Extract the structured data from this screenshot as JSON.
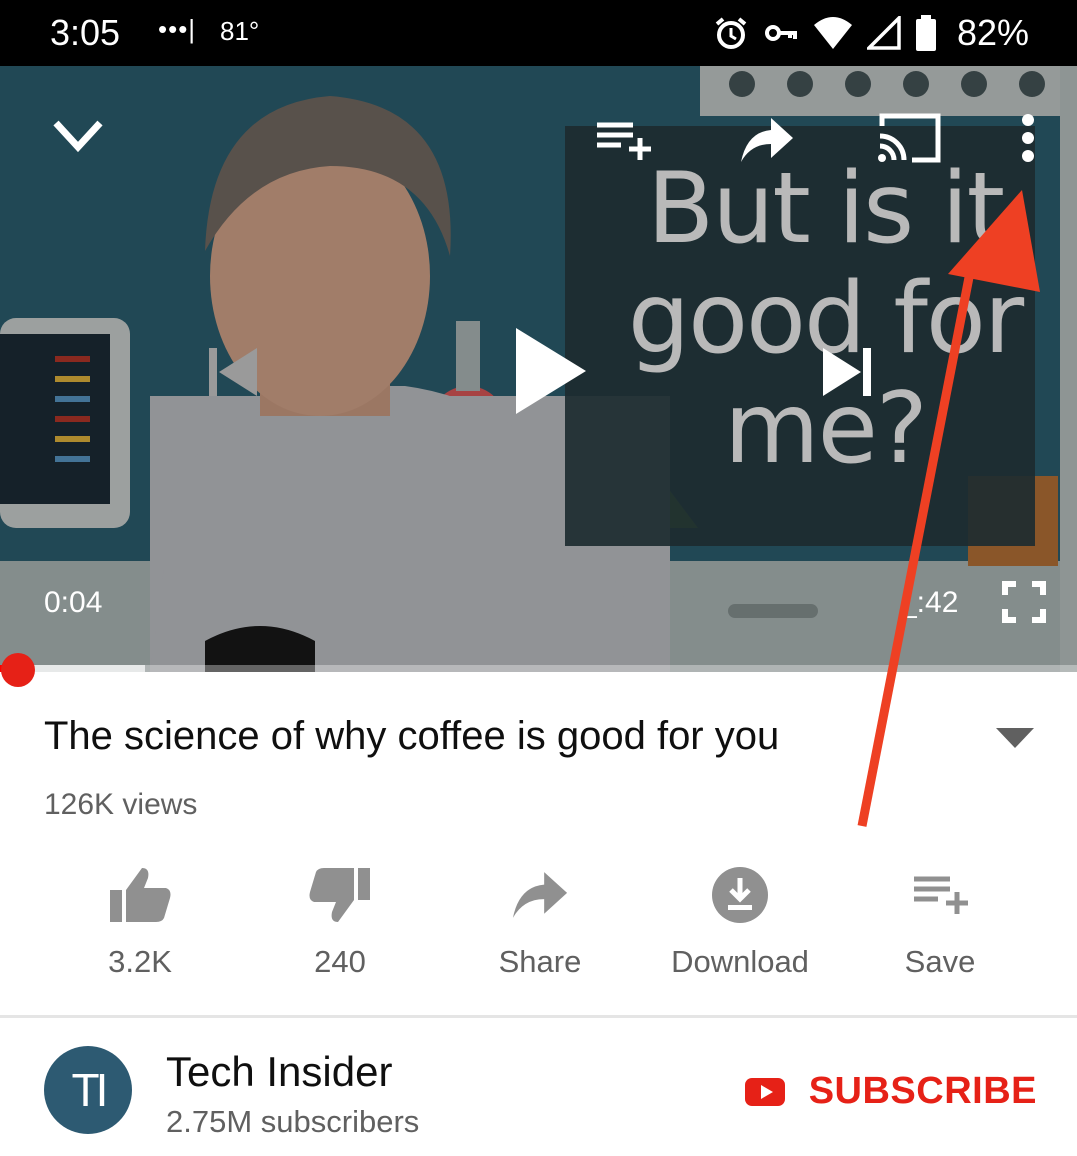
{
  "status_bar": {
    "time": "3:05",
    "signal": "•••|",
    "temperature": "81°",
    "battery": "82%"
  },
  "player": {
    "overlay_text": "But is it good for me?",
    "current_time": "0:04",
    "total_time": "_:42",
    "progress_fraction": 0.005,
    "buffer_fraction": 0.135,
    "icons": [
      "chevron-down-icon",
      "add-to-queue-icon",
      "share-icon",
      "cast-icon",
      "more-vert-icon",
      "previous-icon",
      "play-icon",
      "next-icon",
      "fullscreen-icon"
    ]
  },
  "video": {
    "title": "The science of why coffee is good for you",
    "views": "126K views"
  },
  "actions": {
    "like": "3.2K",
    "dislike": "240",
    "share": "Share",
    "download": "Download",
    "save": "Save"
  },
  "channel": {
    "avatar_text": "TI",
    "name": "Tech Insider",
    "subscribers": "2.75M subscribers",
    "subscribe_label": "SUBSCRIBE"
  },
  "colors": {
    "accent_red": "#e62117",
    "annotation_arrow": "#ee4023"
  }
}
